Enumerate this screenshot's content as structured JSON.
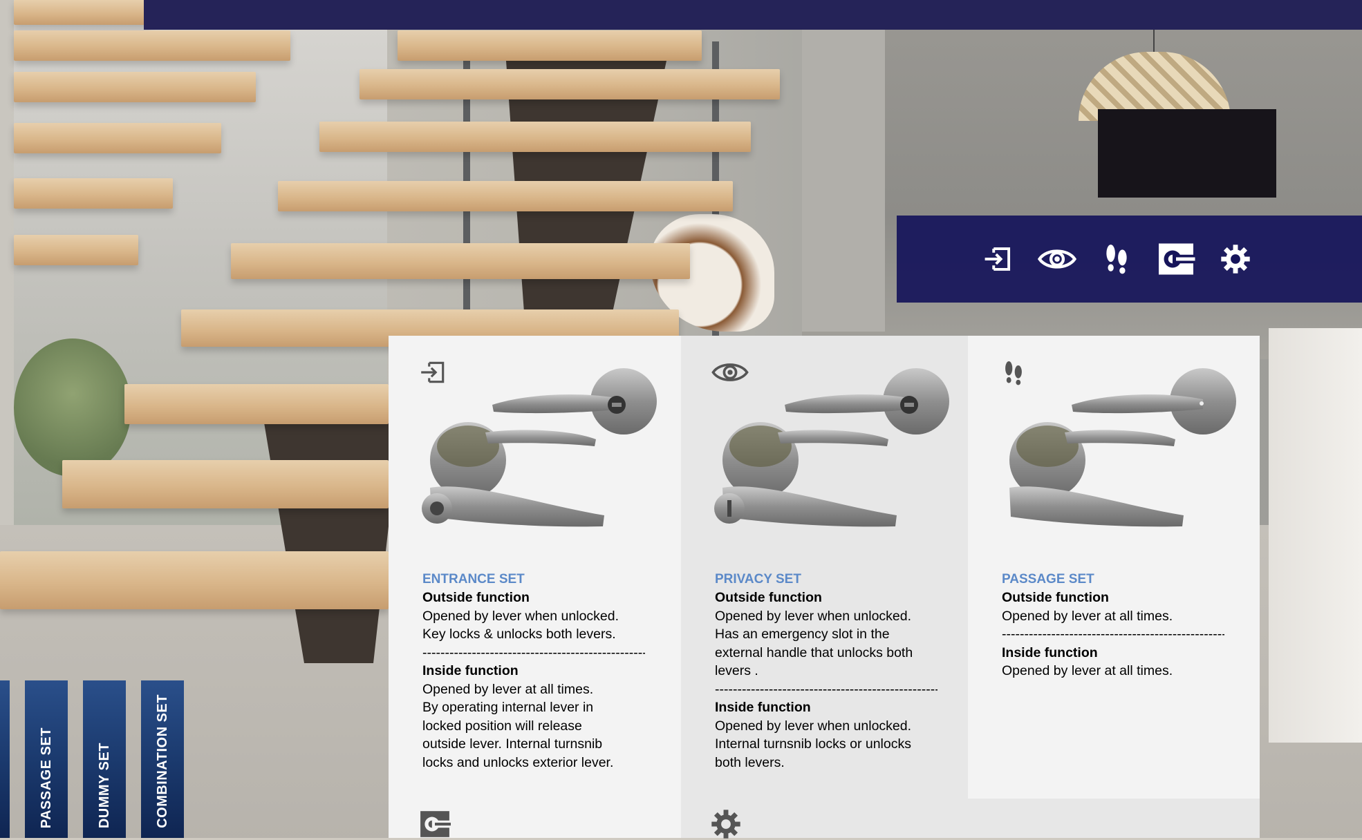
{
  "colors": {
    "top_bar": "#252358",
    "icon_bar": "#16145a",
    "set_title": "#5b89c8",
    "tab_blue": "#1b3a6e"
  },
  "icon_bar": {
    "icons": [
      "entrance-icon",
      "privacy-eye-icon",
      "passage-footprints-icon",
      "dummy-icon",
      "combination-gear-icon"
    ]
  },
  "panels": [
    {
      "icon": "entrance-icon",
      "title": "ENTRANCE SET",
      "outside_title": "Outside function",
      "outside_text": "Opened by lever when unlocked.\nKey locks & unlocks both levers.",
      "divider": "-----------------------------------------------------",
      "inside_title": "Inside function",
      "inside_text": "Opened by lever at all times.\nBy operating internal lever in\nlocked position will release\noutside lever. Internal turnsnib\nlocks and unlocks exterior lever."
    },
    {
      "icon": "privacy-eye-icon",
      "title": "PRIVACY SET",
      "outside_title": "Outside function",
      "outside_text": "Opened by lever when unlocked.\nHas an emergency slot in the\nexternal handle that unlocks both\nlevers .",
      "divider": "-----------------------------------------------------",
      "inside_title": "Inside function",
      "inside_text": "Opened by lever when unlocked.\nInternal turnsnib locks or unlocks\nboth levers."
    },
    {
      "icon": "passage-footprints-icon",
      "title": "PASSAGE SET",
      "outside_title": "Outside function",
      "outside_text": "Opened by lever at all times.",
      "divider": "-----------------------------------------------------",
      "inside_title": "Inside function",
      "inside_text": "Opened by lever at all times."
    }
  ],
  "tabs": [
    {
      "label": "PASSAGE SET"
    },
    {
      "label": "DUMMY SET"
    },
    {
      "label": "COMBINATION SET"
    }
  ]
}
